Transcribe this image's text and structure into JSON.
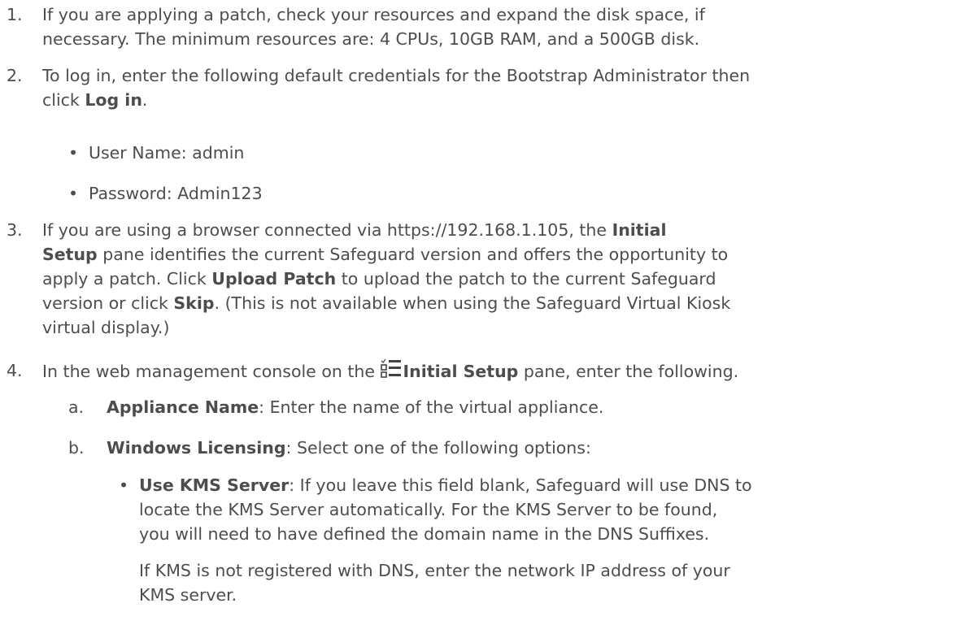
{
  "steps": [
    {
      "num": "1.",
      "lines": [
        "If you are applying a patch, check your resources and expand the disk space, if",
        "necessary. The minimum resources are: 4 CPUs, 10GB RAM, and a 500GB disk."
      ]
    },
    {
      "num": "2.",
      "line1": "To log in, enter the following default credentials for the Bootstrap Administrator then",
      "line2_pre": "click ",
      "line2_bold": "Log in",
      "line2_post": ".",
      "bullets": [
        "User Name: admin",
        "Password: Admin123"
      ]
    },
    {
      "num": "3.",
      "l1_pre": "If you are using a browser connected via https://192.168.1.105, the ",
      "l1_bold": "Initial",
      "l2_bold": "Setup",
      "l2_post": " pane identifies the current Safeguard version and offers the opportunity to",
      "l3_pre": "apply a patch. Click ",
      "l3_bold": "Upload Patch",
      "l3_post": " to upload the patch to the current Safeguard",
      "l4_pre": "version or click ",
      "l4_bold": "Skip",
      "l4_post": ". (This is not available when using the Safeguard Virtual Kiosk",
      "l5": "virtual display.)"
    },
    {
      "num": "4.",
      "pre": "In the web management console on the ",
      "bold": "Initial Setup",
      "post": " pane, enter the following.",
      "sub": [
        {
          "letter": "a.",
          "bold": "Appliance Name",
          "text": ": Enter the name of the virtual appliance."
        },
        {
          "letter": "b.",
          "bold": "Windows Licensing",
          "text": ": Select one of the following options:"
        }
      ],
      "option": {
        "bold": "Use KMS Server",
        "l1": ": If you leave this field blank, Safeguard will use DNS to",
        "l2": "locate the KMS Server automatically. For the KMS Server to be found,",
        "l3": "you will need to have defined the domain name in the DNS Suffixes.",
        "p2_l1": "If KMS is not registered with DNS, enter the network IP address of your",
        "p2_l2": "KMS server."
      }
    }
  ],
  "bullet_char": "•"
}
